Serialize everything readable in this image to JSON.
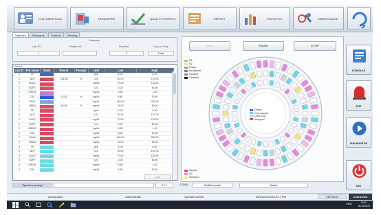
{
  "toolbar": {
    "customer_data": "CUSTOMER DATA",
    "parameter": "PARAMETER",
    "quality_control": "QUALITY CONTROL",
    "report": "REPORT",
    "statistics": "STATISTICS",
    "maintenance": "MAINTENANCE"
  },
  "tabs": [
    "Samples",
    "Standards",
    "Controls",
    "Warning"
  ],
  "sample": {
    "section": "Samples",
    "lab_id_label": "Lab ID",
    "patient_id_label": "Patient ID",
    "position_label": "Position",
    "cup_tube_label": "Cup or Tube",
    "lab_id_value": "1",
    "position_value": "3",
    "cup_tube_value": "Tube"
  },
  "result": {
    "title": "Result",
    "headers": [
      "Lab ID",
      "Pat name",
      "State",
      "Result",
      "Prompt",
      "Unit",
      "Low",
      "High"
    ],
    "rows": [
      [
        "1",
        "TP",
        "#4a66c9",
        "",
        "",
        "g/dL",
        "6.00",
        "8.30"
      ],
      [
        "1",
        "ALP",
        "#d94a63",
        "131.56",
        "H",
        "U/L",
        "20.00",
        "137.00"
      ],
      [
        "1",
        "GLUC",
        "#d94a63",
        "",
        "",
        "mg/dL",
        "70.00",
        "110.00"
      ],
      [
        "1",
        "SGPT",
        "#d94a63",
        "",
        "",
        "U/L",
        "0.00",
        "45.00"
      ],
      [
        "1",
        "CREAT",
        "#c07ad0",
        "",
        "",
        "mg/dL",
        "0.50",
        "1.40"
      ],
      [
        "1",
        "CAL",
        "#2f5bd1",
        "13.01",
        "H",
        "mg/dL",
        "8.40",
        "10.40"
      ],
      [
        "1",
        "CHOL",
        "#7aa3e6",
        "",
        "",
        "mg/dL",
        "140.00",
        "250.00"
      ],
      [
        "1",
        "UREA",
        "#d94a63",
        "46.58",
        "H",
        "mg/dL",
        "15.00",
        "45.00"
      ],
      [
        "2",
        "TP",
        "#d94a63",
        "",
        "",
        "g/dL",
        "6.00",
        "8.30"
      ],
      [
        "2",
        "ALP",
        "#d94a63",
        "",
        "",
        "U/L",
        "20.00",
        "137.00"
      ],
      [
        "2",
        "GLUC",
        "#d94a63",
        "",
        "",
        "mg/dL",
        "70.00",
        "110.00"
      ],
      [
        "2",
        "SGPT",
        "#d94a63",
        "",
        "",
        "U/L",
        "0.00",
        "45.00"
      ],
      [
        "2",
        "CREAT",
        "#d94a63",
        "",
        "",
        "mg/dL",
        "0.50",
        "1.40"
      ],
      [
        "2",
        "CAL",
        "#d94a63",
        "",
        "",
        "mg/dL",
        "8.40",
        "10.40"
      ],
      [
        "2",
        "CHOL",
        "#d94a63",
        "",
        "",
        "mg/dL",
        "140.00",
        "250.00"
      ],
      [
        "2",
        "UREA",
        "#d94a63",
        "",
        "",
        "mg/dL",
        "15.00",
        "45.00"
      ],
      [
        "3",
        "TP",
        "#6fd8e8",
        "",
        "",
        "g/dL",
        "6.00",
        "8.30"
      ],
      [
        "3",
        "ALP",
        "#6fd8e8",
        "",
        "",
        "U/L",
        "20.00",
        "137.00"
      ],
      [
        "3",
        "GLUC",
        "#6fd8e8",
        "",
        "",
        "mg/dL",
        "70.00",
        "110.00"
      ],
      [
        "3",
        "SGPT",
        "#6fd8e8",
        "",
        "",
        "U/L",
        "0.00",
        "45.00"
      ],
      [
        "3",
        "CREAT",
        "#6fd8e8",
        "",
        "",
        "mg/dL",
        "0.50",
        "1.40"
      ],
      [
        "3",
        "CAL",
        "#6fd8e8",
        "",
        "",
        "mg/dL",
        "8.40",
        "10.40"
      ]
    ]
  },
  "bottom": {
    "operator_prompt": "Operator prompt",
    "temperature": "37.0",
    "com": "COM3",
    "water": "Distilled water",
    "waste": "Waste",
    "hide": "Hide"
  },
  "status": {
    "app": "AutoQuant2",
    "admin": "Administrator",
    "operator": "Operator Admin",
    "datetime": "06/13/2023  08:13:17 PM",
    "version": "VERSION",
    "connected": "Connected"
  },
  "side": {
    "schedule": "SCHEDULE",
    "stat": "STAT",
    "run_monitor": "RUN MONITOR",
    "exit": "EXIT"
  },
  "analyzer": {
    "start_label": "Start",
    "pause_label": "Pause",
    "stop_label": "STOP",
    "legend_top": [
      "R1",
      "R2",
      "Drawn",
      "Insufficient",
      "Exhaust",
      "Cleanser"
    ],
    "legend_center": [
      "Drawn",
      "Only sample",
      "Clean cup",
      "Wrapped"
    ],
    "legend_bottom": [
      "Sample",
      "QC",
      "Standard"
    ]
  },
  "taskbar": {
    "time": "19:57",
    "date": "06/13/2023",
    "lang": "ENG"
  },
  "colors": {
    "accent": "#5d6f88",
    "positive": "#4a66c9",
    "alert": "#d94a63",
    "cyan": "#6fd8e8"
  }
}
